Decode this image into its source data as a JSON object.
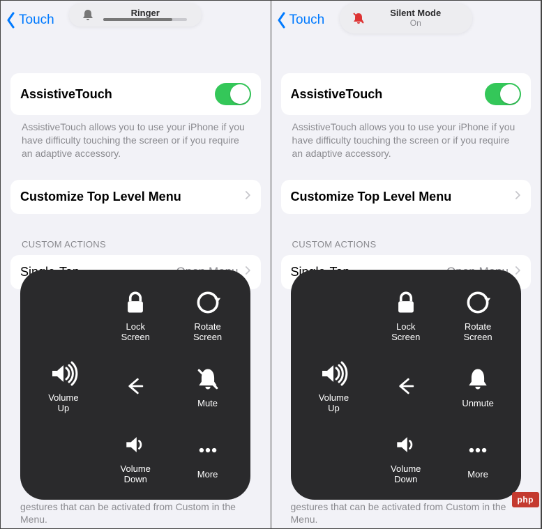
{
  "left": {
    "back": "Touch",
    "hud": {
      "title": "Ringer"
    },
    "assistive": "AssistiveTouch",
    "desc": "AssistiveTouch allows you to use your iPhone if you have difficulty touching the screen or if you require an adaptive accessory.",
    "customize": "Customize Top Level Menu",
    "sectionHeader": "CUSTOM ACTIONS",
    "singleTap": "Single-Tap",
    "singleTapValue": "Open Menu",
    "footer": "gestures that can be activated from Custom in the Menu.",
    "overlay": {
      "lock": "Lock\nScreen",
      "rotate": "Rotate\nScreen",
      "volUp": "Volume\nUp",
      "mute": "Mute",
      "volDown": "Volume\nDown",
      "more": "More"
    }
  },
  "right": {
    "back": "Touch",
    "hud": {
      "title": "Silent Mode",
      "sub": "On"
    },
    "assistive": "AssistiveTouch",
    "desc": "AssistiveTouch allows you to use your iPhone if you have difficulty touching the screen or if you require an adaptive accessory.",
    "customize": "Customize Top Level Menu",
    "sectionHeader": "CUSTOM ACTIONS",
    "singleTap": "Single-Tap",
    "singleTapValue": "Open Menu",
    "footer": "gestures that can be activated from Custom in the Menu.",
    "overlay": {
      "lock": "Lock\nScreen",
      "rotate": "Rotate\nScreen",
      "volUp": "Volume\nUp",
      "unmute": "Unmute",
      "volDown": "Volume\nDown",
      "more": "More"
    }
  },
  "watermark": "php"
}
